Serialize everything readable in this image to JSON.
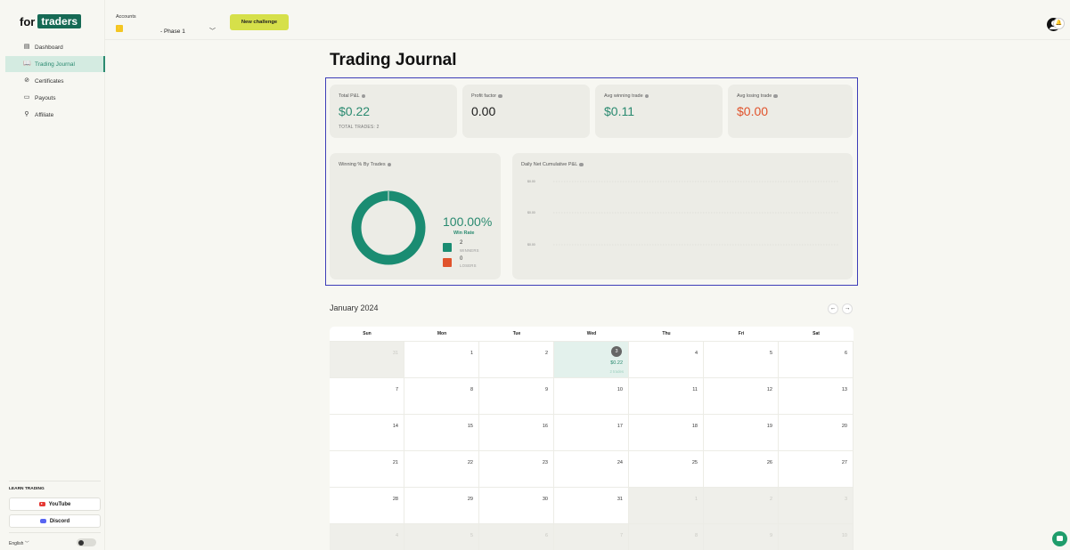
{
  "brand": {
    "prefix": "for",
    "highlight": "traders"
  },
  "sidebar": {
    "items": [
      {
        "label": "Dashboard",
        "icon": "dashboard-icon",
        "active": false
      },
      {
        "label": "Trading Journal",
        "icon": "book-icon",
        "active": true
      },
      {
        "label": "Certificates",
        "icon": "certificate-icon",
        "active": false
      },
      {
        "label": "Payouts",
        "icon": "wallet-icon",
        "active": false
      },
      {
        "label": "Affiliate",
        "icon": "link-icon",
        "active": false
      }
    ],
    "learn_heading": "LEARN TRADING",
    "youtube_label": "YouTube",
    "discord_label": "Discord",
    "language": "English"
  },
  "topbar": {
    "accounts_label": "Accounts",
    "account_phase": "- Phase 1",
    "new_challenge_label": "New challenge"
  },
  "page": {
    "title": "Trading Journal"
  },
  "stats": {
    "total_pl": {
      "label": "Total P&L",
      "value": "$0.22",
      "sub": "TOTAL TRADES: 2"
    },
    "profit_factor": {
      "label": "Profit factor",
      "value": "0.00"
    },
    "avg_win": {
      "label": "Avg winning trade",
      "value": "$0.11"
    },
    "avg_loss": {
      "label": "Avg losing trade",
      "value": "$0.00"
    }
  },
  "winning": {
    "label": "Winning % By Trades",
    "pct": "100.00%",
    "win_rate_label": "Win Rate",
    "winners_count": "2",
    "winners_label": "WINNERS",
    "losers_count": "0",
    "losers_label": "LOSERS",
    "win_fraction": 1.0
  },
  "daily_chart": {
    "label": "Daily Net Cumulative P&L",
    "ticks": [
      "$0.00",
      "$0.00",
      "$0.00"
    ]
  },
  "calendar": {
    "month": "January 2024",
    "prev_icon": "←",
    "next_icon": "→",
    "days": [
      "Sun",
      "Mon",
      "Tue",
      "Wed",
      "Thu",
      "Fri",
      "Sat"
    ],
    "weeks": [
      [
        "31",
        "1",
        "2",
        "3",
        "4",
        "5",
        "6"
      ],
      [
        "7",
        "8",
        "9",
        "10",
        "11",
        "12",
        "13"
      ],
      [
        "14",
        "15",
        "16",
        "17",
        "18",
        "19",
        "20"
      ],
      [
        "21",
        "22",
        "23",
        "24",
        "25",
        "26",
        "27"
      ],
      [
        "28",
        "29",
        "30",
        "31",
        "1",
        "2",
        "3"
      ],
      [
        "4",
        "5",
        "6",
        "7",
        "8",
        "9",
        "10"
      ]
    ],
    "selected": {
      "pnl": "$0.22",
      "trades": "2 trades"
    }
  },
  "colors": {
    "green": "#2a8a70",
    "red": "#e0532c",
    "accent": "#d6e04a",
    "donut": "#1a8c72"
  }
}
